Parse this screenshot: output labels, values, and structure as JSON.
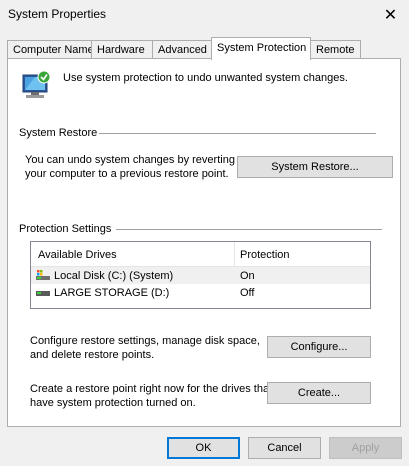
{
  "window": {
    "title": "System Properties",
    "close_glyph": "✕"
  },
  "tabs": [
    {
      "label": "Computer Name"
    },
    {
      "label": "Hardware"
    },
    {
      "label": "Advanced"
    },
    {
      "label": "System Protection"
    },
    {
      "label": "Remote"
    }
  ],
  "active_tab": "System Protection",
  "header": {
    "text": "Use system protection to undo unwanted system changes."
  },
  "system_restore": {
    "section_title": "System Restore",
    "description_line1": "You can undo system changes by reverting",
    "description_line2": "your computer to a previous restore point.",
    "button_label": "System Restore..."
  },
  "protection_settings": {
    "section_title": "Protection Settings",
    "columns": [
      "Available Drives",
      "Protection"
    ],
    "drives": [
      {
        "name": "Local Disk (C:) (System)",
        "protection": "On",
        "icon": "system-drive-icon",
        "selected": true
      },
      {
        "name": "LARGE STORAGE (D:)",
        "protection": "Off",
        "icon": "drive-icon",
        "selected": false
      }
    ],
    "configure_line1": "Configure restore settings, manage disk space,",
    "configure_line2": "and delete restore points.",
    "configure_label": "Configure...",
    "create_line1": "Create a restore point right now for the drives that",
    "create_line2": "have system protection turned on.",
    "create_label": "Create..."
  },
  "footer": {
    "ok_label": "OK",
    "cancel_label": "Cancel",
    "apply_label": "Apply",
    "apply_enabled": false
  },
  "colors": {
    "accent": "#0078d7",
    "panel_bg": "#ffffff",
    "dialog_bg": "#f0f0f0"
  }
}
